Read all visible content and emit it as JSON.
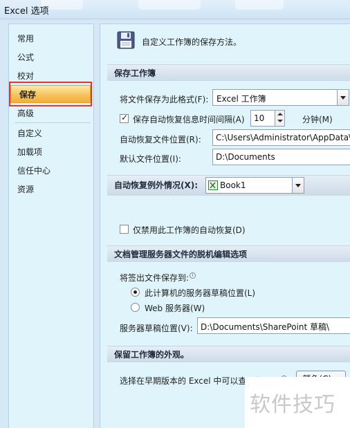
{
  "window": {
    "title": "Excel 选项"
  },
  "nav": {
    "items": [
      {
        "label": "常用"
      },
      {
        "label": "公式"
      },
      {
        "label": "校对"
      },
      {
        "label": "保存",
        "selected": true
      },
      {
        "label": "高级"
      },
      {
        "label": "自定义"
      },
      {
        "label": "加载项"
      },
      {
        "label": "信任中心"
      },
      {
        "label": "资源"
      }
    ]
  },
  "header": {
    "icon": "save-icon",
    "text": "自定义工作簿的保存方法。"
  },
  "save_section": {
    "title": "保存工作簿",
    "format_label": "将文件保存为此格式(F):",
    "format_value": "Excel 工作簿",
    "autorecover_label": "保存自动恢复信息时间间隔(A)",
    "autorecover_checked": true,
    "autorecover_minutes": "10",
    "minutes_label": "分钟(M)",
    "autorecover_location_label": "自动恢复文件位置(R):",
    "autorecover_location_value": "C:\\Users\\Administrator\\AppData\\Roaming\\Microsoft\\Excel\\",
    "default_location_label": "默认文件位置(I):",
    "default_location_value": "D:\\Documents"
  },
  "autorecover_exceptions": {
    "title": "自动恢复例外情况(X):",
    "workbook_value": "Book1",
    "disable_label": "仅禁用此工作簿的自动恢复(D)",
    "disable_checked": false
  },
  "offline_section": {
    "title": "文档管理服务器文件的脱机编辑选项",
    "checkout_label": "将签出文件保存到:",
    "radio_local_label": "此计算机的服务器草稿位置(L)",
    "radio_local_checked": true,
    "radio_web_label": "Web 服务器(W)",
    "radio_web_checked": false,
    "drafts_label": "服务器草稿位置(V):",
    "drafts_value": "D:\\Documents\\SharePoint 草稿\\"
  },
  "appearance_section": {
    "title": "保留工作簿的外观。",
    "colors_label": "选择在早期版本的 Excel 中可以查看的颜色:",
    "colors_button": "颜色(C)..."
  },
  "watermark": {
    "text": "软件技巧"
  },
  "colors": {
    "nav_selected": "#f8c25e",
    "highlight_outline": "#e8332a",
    "panel_bg": "#dff5fb"
  }
}
